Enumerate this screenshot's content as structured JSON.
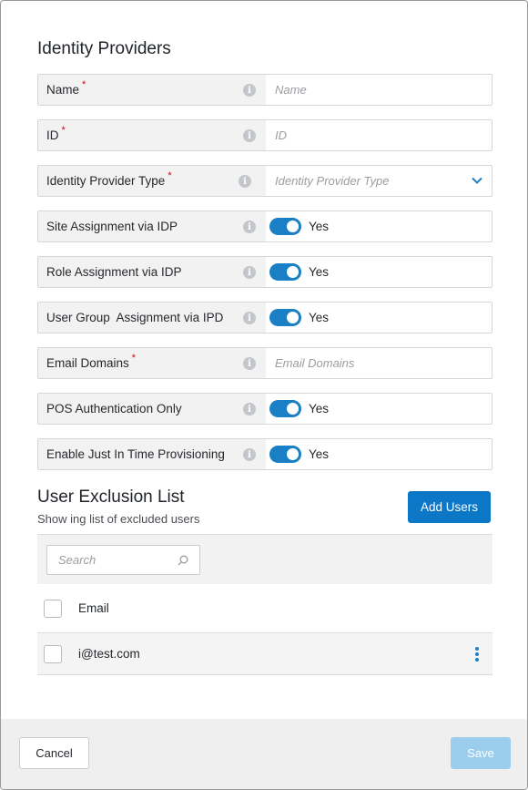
{
  "dialog": {
    "title": "Identity Providers"
  },
  "fields": [
    {
      "label": "Name",
      "required": "*",
      "type": "text",
      "placeholder": "Name"
    },
    {
      "label": "ID",
      "required": "*",
      "type": "text",
      "placeholder": "ID"
    },
    {
      "label": "Identity Provider Type",
      "required": "*",
      "type": "select",
      "placeholder": "Identity Provider Type"
    },
    {
      "label": "Site Assignment via IDP",
      "required": "",
      "type": "toggle",
      "value": "Yes"
    },
    {
      "label": "Role Assignment via IDP",
      "required": "",
      "type": "toggle",
      "value": "Yes"
    },
    {
      "label": "User Group  Assignment via IPD",
      "required": "",
      "type": "toggle",
      "value": "Yes"
    },
    {
      "label": "Email Domains",
      "required": "*",
      "type": "text",
      "placeholder": "Email Domains"
    },
    {
      "label": "POS Authentication Only",
      "required": "",
      "type": "toggle",
      "value": "Yes"
    },
    {
      "label": "Enable Just In Time Provisioning",
      "required": "",
      "type": "toggle",
      "value": "Yes"
    }
  ],
  "exclusion": {
    "title": "User Exclusion List",
    "subtitle": "Show ing list of excluded users",
    "add_button": "Add Users",
    "search_placeholder": "Search",
    "column_header": "Email",
    "rows": [
      {
        "email": "i@test.com"
      }
    ]
  },
  "footer": {
    "cancel_label": "Cancel",
    "save_label": "Save"
  },
  "colors": {
    "accent": "#0d77c7",
    "toggle_on": "#1a7fc4",
    "required": "#d0021b",
    "save_disabled": "#9dcdec"
  },
  "icons": {
    "info": "info-icon",
    "dropdown": "chevron-down-icon",
    "search": "search-icon",
    "row_menu": "more-vertical-icon"
  }
}
